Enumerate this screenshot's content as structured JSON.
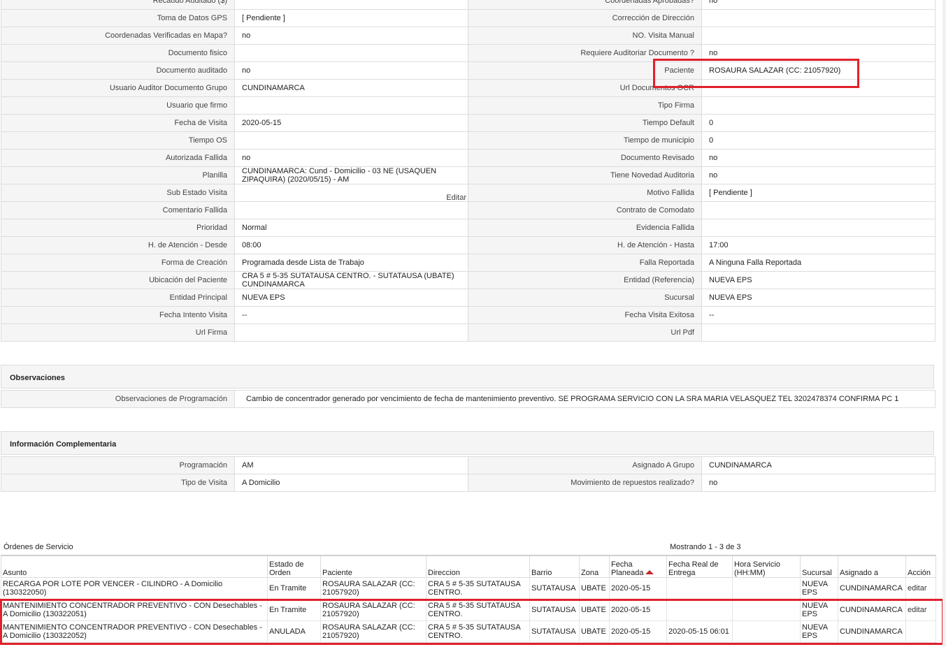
{
  "details": [
    [
      "Recaudo Auditado ($)",
      "",
      "Coordenadas Aprobadas?",
      "no"
    ],
    [
      "Toma de Datos GPS",
      "[ Pendiente ]",
      "Corrección de Dirección",
      ""
    ],
    [
      "Coordenadas Verificadas en Mapa?",
      "no",
      "NO. Visita Manual",
      ""
    ],
    [
      "Documento fisico",
      "",
      "Requiere Auditoriar Documento ?",
      "no"
    ],
    [
      "Documento auditado",
      "no",
      "Paciente",
      "ROSAURA SALAZAR (CC: 21057920)"
    ],
    [
      "Usuario Auditor Documento Grupo",
      "CUNDINAMARCA",
      "Url Documentos OCR",
      ""
    ],
    [
      "Usuario que firmo",
      "",
      "Tipo Firma",
      ""
    ],
    [
      "Fecha de Visita",
      "2020-05-15",
      "Tiempo Default",
      "0"
    ],
    [
      "Tiempo OS",
      "",
      "Tiempo de municipio",
      "0"
    ],
    [
      "Autorizada Fallida",
      "no",
      "Documento Revisado",
      "no"
    ],
    [
      "Planilla",
      "CUNDINAMARCA: Cund - Domicilio - 03 NE (USAQUEN ZIPAQUIRA) (2020/05/15) - AM",
      "Tiene Novedad Auditoria",
      "no"
    ],
    [
      "Sub Estado Visita",
      "",
      "Motivo Fallida",
      "[ Pendiente ]"
    ],
    [
      "Comentario Fallida",
      "",
      "Contrato de Comodato",
      ""
    ],
    [
      "Prioridad",
      "Normal",
      "Evidencia Fallida",
      ""
    ],
    [
      "H. de Atención - Desde",
      "08:00",
      "H. de Atención - Hasta",
      "17:00"
    ],
    [
      "Forma de Creación",
      "Programada desde Lista de Trabajo",
      "Falla Reportada",
      "A Ninguna Falla Reportada"
    ],
    [
      "Ubicación del Paciente",
      "CRA 5 # 5-35 SUTATAUSA CENTRO. - SUTATAUSA (UBATE) CUNDINAMARCA",
      "Entidad (Referencia)",
      "NUEVA EPS"
    ],
    [
      "Entidad Principal",
      "NUEVA EPS",
      "Sucursal",
      "NUEVA EPS"
    ],
    [
      "Fecha Intento Visita",
      "--",
      "Fecha Visita Exitosa",
      "--"
    ],
    [
      "Url Firma",
      "",
      "Url Pdf",
      ""
    ]
  ],
  "edit_label": "Editar",
  "observaciones": {
    "title": "Observaciones",
    "label": "Observaciones de Programación",
    "value": "Cambio de concentrador generado por vencimiento de fecha de mantenimiento preventivo. SE PROGRAMA SERVICIO CON LA SRA MARIA VELASQUEZ TEL 3202478374 CONFIRMA PC 1"
  },
  "info": {
    "title": "Información Complementaria",
    "rows": [
      [
        "Programación",
        "AM",
        "Asignado A Grupo",
        "CUNDINAMARCA"
      ],
      [
        "Tipo de Visita",
        "A Domicilio",
        "Movimiento de repuestos realizado?",
        "no"
      ]
    ]
  },
  "orders": {
    "title": "Órdenes de Servicio",
    "count_text": "Mostrando 1 - 3 de 3",
    "headers": [
      "Asunto",
      "Estado de Orden",
      "Paciente",
      "Direccion",
      "Barrio",
      "Zona",
      "Fecha Planeada",
      "Fecha Real de Entrega",
      "Hora Servicio (HH:MM)",
      "Sucursal",
      "Asignado a",
      "Acción"
    ],
    "rows": [
      [
        "RECARGA POR LOTE POR VENCER - CILINDRO - A Domicilio (130322050)",
        "En Tramite",
        "ROSAURA SALAZAR (CC: 21057920)",
        "CRA 5 # 5-35 SUTATAUSA CENTRO.",
        "SUTATAUSA",
        "UBATE",
        "2020-05-15",
        "",
        "",
        "NUEVA EPS",
        "CUNDINAMARCA",
        "editar"
      ],
      [
        "MANTENIMIENTO CONCENTRADOR PREVENTIVO - CON Desechables - A Domicilio (130322051)",
        "En Tramite",
        "ROSAURA SALAZAR (CC: 21057920)",
        "CRA 5 # 5-35 SUTATAUSA CENTRO.",
        "SUTATAUSA",
        "UBATE",
        "2020-05-15",
        "",
        "",
        "NUEVA EPS",
        "CUNDINAMARCA",
        "editar"
      ],
      [
        "MANTENIMIENTO CONCENTRADOR PREVENTIVO - CON Desechables - A Domicilio (130322052)",
        "ANULADA",
        "ROSAURA SALAZAR (CC: 21057920)",
        "CRA 5 # 5-35 SUTATAUSA CENTRO.",
        "SUTATAUSA",
        "UBATE",
        "2020-05-15",
        "2020-05-15 06:01",
        "",
        "NUEVA EPS",
        "CUNDINAMARCA",
        ""
      ]
    ]
  },
  "colors": {
    "highlight": "#e0202a",
    "label_bg": "#f5f5f5",
    "border": "#dcdcdc"
  }
}
